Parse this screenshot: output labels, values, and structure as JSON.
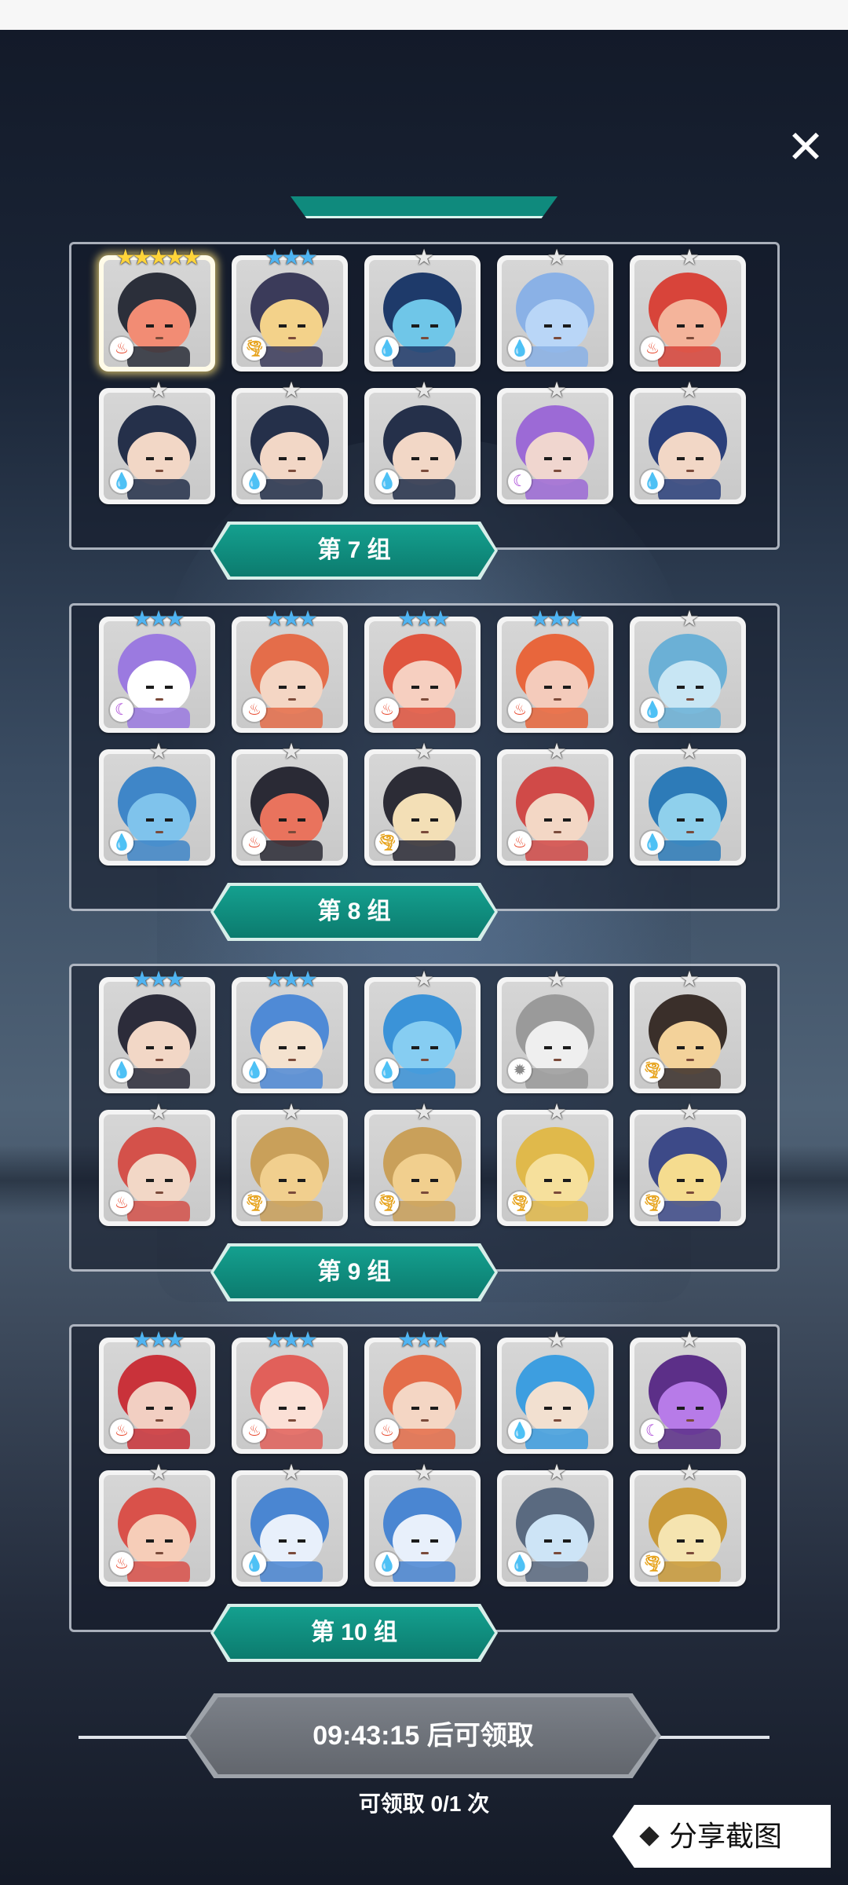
{
  "close_glyph": "✕",
  "groups": [
    {
      "label": "第 7 组",
      "heroes": [
        {
          "stars": "★★★★★",
          "star_color": "gold",
          "element": "fire",
          "palette": [
            "#f28c74",
            "#2b2f3a"
          ],
          "highlight": true
        },
        {
          "stars": "★★★",
          "star_color": "blue",
          "element": "wind",
          "palette": [
            "#f3d28a",
            "#3b3b5a"
          ]
        },
        {
          "stars": "★",
          "star_color": "grey",
          "element": "water",
          "palette": [
            "#6fc6e8",
            "#1e3a6a"
          ]
        },
        {
          "stars": "★",
          "star_color": "grey",
          "element": "water",
          "palette": [
            "#b9d6f7",
            "#8ab1e6"
          ]
        },
        {
          "stars": "★",
          "star_color": "grey",
          "element": "fire",
          "palette": [
            "#f4b49b",
            "#d8443a"
          ]
        },
        {
          "stars": "★",
          "star_color": "grey",
          "element": "water",
          "palette": [
            "#f2d7c6",
            "#25304a"
          ]
        },
        {
          "stars": "★",
          "star_color": "grey",
          "element": "water",
          "palette": [
            "#f2d7c6",
            "#25304a"
          ]
        },
        {
          "stars": "★",
          "star_color": "grey",
          "element": "water",
          "palette": [
            "#f2d7c6",
            "#25304a"
          ]
        },
        {
          "stars": "★",
          "star_color": "grey",
          "element": "dark",
          "palette": [
            "#f0d6cf",
            "#9c6ad6"
          ]
        },
        {
          "stars": "★",
          "star_color": "grey",
          "element": "water",
          "palette": [
            "#f2d7c6",
            "#2a3f7a"
          ]
        }
      ]
    },
    {
      "label": "第 8 组",
      "heroes": [
        {
          "stars": "★★★",
          "star_color": "blue",
          "element": "dark",
          "palette": [
            "#ffffff",
            "#9b7ae0"
          ]
        },
        {
          "stars": "★★★",
          "star_color": "blue",
          "element": "fire",
          "palette": [
            "#f4d6c4",
            "#e46d4a"
          ]
        },
        {
          "stars": "★★★",
          "star_color": "blue",
          "element": "fire",
          "palette": [
            "#f6cfc0",
            "#e0553f"
          ]
        },
        {
          "stars": "★★★",
          "star_color": "blue",
          "element": "fire",
          "palette": [
            "#f4cbbb",
            "#e8663c"
          ]
        },
        {
          "stars": "★",
          "star_color": "grey",
          "element": "water",
          "palette": [
            "#c8e6f4",
            "#6bb0d6"
          ]
        },
        {
          "stars": "★",
          "star_color": "grey",
          "element": "water",
          "palette": [
            "#7fc3ec",
            "#3f86c8"
          ]
        },
        {
          "stars": "★",
          "star_color": "grey",
          "element": "fire",
          "palette": [
            "#e9735d",
            "#2a2a35"
          ]
        },
        {
          "stars": "★",
          "star_color": "grey",
          "element": "wind",
          "palette": [
            "#f3dfb6",
            "#2c2c36"
          ]
        },
        {
          "stars": "★",
          "star_color": "grey",
          "element": "fire",
          "palette": [
            "#f3d7c5",
            "#d04a48"
          ]
        },
        {
          "stars": "★",
          "star_color": "grey",
          "element": "water",
          "palette": [
            "#8fd0ec",
            "#2d7bb8"
          ]
        }
      ]
    },
    {
      "label": "第 9 组",
      "heroes": [
        {
          "stars": "★★★",
          "star_color": "blue",
          "element": "water",
          "palette": [
            "#f2d7c6",
            "#2c2c3a"
          ]
        },
        {
          "stars": "★★★",
          "star_color": "blue",
          "element": "water",
          "palette": [
            "#f4e2cf",
            "#4f8ad6"
          ]
        },
        {
          "stars": "★",
          "star_color": "grey",
          "element": "water",
          "palette": [
            "#86cdf2",
            "#3b93d8"
          ]
        },
        {
          "stars": "★",
          "star_color": "grey",
          "element": "light",
          "palette": [
            "#efefef",
            "#9a9a9a"
          ]
        },
        {
          "stars": "★",
          "star_color": "grey",
          "element": "wind",
          "palette": [
            "#f3d29a",
            "#3a2f2a"
          ]
        },
        {
          "stars": "★",
          "star_color": "grey",
          "element": "fire",
          "palette": [
            "#f2d7c6",
            "#d4514a"
          ]
        },
        {
          "stars": "★",
          "star_color": "grey",
          "element": "wind",
          "palette": [
            "#f1cf8e",
            "#c9a05a"
          ]
        },
        {
          "stars": "★",
          "star_color": "grey",
          "element": "wind",
          "palette": [
            "#f1cf8e",
            "#c9a05a"
          ]
        },
        {
          "stars": "★",
          "star_color": "grey",
          "element": "wind",
          "palette": [
            "#f6e09c",
            "#e0b94b"
          ]
        },
        {
          "stars": "★",
          "star_color": "grey",
          "element": "wind",
          "palette": [
            "#f5dc8f",
            "#3d4a88"
          ]
        }
      ]
    },
    {
      "label": "第 10 组",
      "heroes": [
        {
          "stars": "★★★",
          "star_color": "blue",
          "element": "fire",
          "palette": [
            "#f2cfc2",
            "#c9323a"
          ]
        },
        {
          "stars": "★★★",
          "star_color": "blue",
          "element": "fire",
          "palette": [
            "#fbe0d6",
            "#e1605a"
          ]
        },
        {
          "stars": "★★★",
          "star_color": "blue",
          "element": "fire",
          "palette": [
            "#f4d6c4",
            "#e46d4a"
          ]
        },
        {
          "stars": "★",
          "star_color": "grey",
          "element": "water",
          "palette": [
            "#f2e0d0",
            "#3d9ee0"
          ]
        },
        {
          "stars": "★",
          "star_color": "grey",
          "element": "dark",
          "palette": [
            "#b77be8",
            "#5c2f88"
          ]
        },
        {
          "stars": "★",
          "star_color": "grey",
          "element": "fire",
          "palette": [
            "#f6cdb8",
            "#d9514a"
          ]
        },
        {
          "stars": "★",
          "star_color": "grey",
          "element": "water",
          "palette": [
            "#e8f0fb",
            "#4a86d2"
          ]
        },
        {
          "stars": "★",
          "star_color": "grey",
          "element": "water",
          "palette": [
            "#e8f0fb",
            "#4a86d2"
          ]
        },
        {
          "stars": "★",
          "star_color": "grey",
          "element": "water",
          "palette": [
            "#cde4f6",
            "#5a6a80"
          ]
        },
        {
          "stars": "★",
          "star_color": "grey",
          "element": "wind",
          "palette": [
            "#f5e4b0",
            "#c99a3a"
          ]
        }
      ]
    }
  ],
  "element_icons": {
    "fire": "♨",
    "water": "💧",
    "wind": "🌪",
    "dark": "☾",
    "light": "✹"
  },
  "timer_text": "09:43:15 后可领取",
  "claim_count": "可领取 0/1 次",
  "share_label": "分享截图",
  "colors": {
    "accent_teal": "#0f8a7d",
    "panel_border": "#dce1eb",
    "button_grey": "#6b7078"
  }
}
